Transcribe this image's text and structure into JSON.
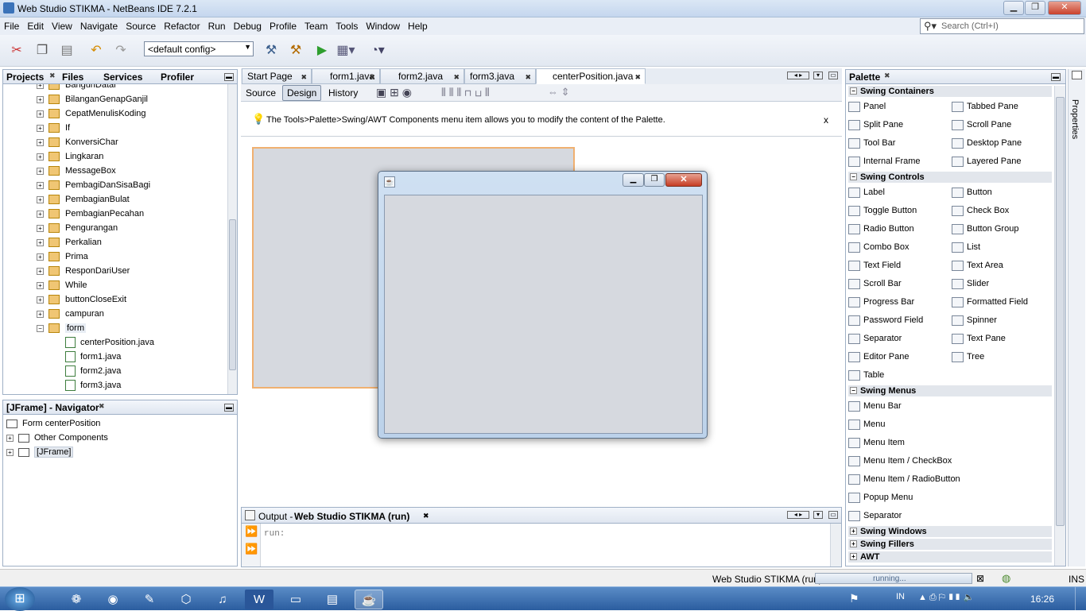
{
  "window": {
    "title": "Web Studio STIKMA - NetBeans IDE 7.2.1"
  },
  "menu": [
    "File",
    "Edit",
    "View",
    "Navigate",
    "Source",
    "Refactor",
    "Run",
    "Debug",
    "Profile",
    "Team",
    "Tools",
    "Window",
    "Help"
  ],
  "toolbar": {
    "config": "<default config>"
  },
  "search": {
    "placeholder": "Search (Ctrl+I)"
  },
  "projects": {
    "tabs": [
      "Projects",
      "Files",
      "Services",
      "Profiler"
    ],
    "tree": [
      {
        "label": "BangunDatar",
        "kind": "pkg"
      },
      {
        "label": "BilanganGenapGanjil",
        "kind": "pkg"
      },
      {
        "label": "CepatMenulisKoding",
        "kind": "pkg"
      },
      {
        "label": "If",
        "kind": "pkg"
      },
      {
        "label": "KonversiChar",
        "kind": "pkg"
      },
      {
        "label": "Lingkaran",
        "kind": "pkg"
      },
      {
        "label": "MessageBox",
        "kind": "pkg"
      },
      {
        "label": "PembagiDanSisaBagi",
        "kind": "pkg"
      },
      {
        "label": "PembagianBulat",
        "kind": "pkg"
      },
      {
        "label": "PembagianPecahan",
        "kind": "pkg"
      },
      {
        "label": "Pengurangan",
        "kind": "pkg"
      },
      {
        "label": "Perkalian",
        "kind": "pkg"
      },
      {
        "label": "Prima",
        "kind": "pkg"
      },
      {
        "label": "ResponDariUser",
        "kind": "pkg"
      },
      {
        "label": "While",
        "kind": "pkg"
      },
      {
        "label": "buttonCloseExit",
        "kind": "pkg"
      },
      {
        "label": "campuran",
        "kind": "pkg"
      },
      {
        "label": "form",
        "kind": "pkg"
      },
      {
        "label": "centerPosition.java",
        "kind": "file"
      },
      {
        "label": "form1.java",
        "kind": "file"
      },
      {
        "label": "form2.java",
        "kind": "file"
      },
      {
        "label": "form3.java",
        "kind": "file"
      }
    ]
  },
  "navigator": {
    "title": "[JFrame] - Navigator",
    "items": [
      "Form centerPosition",
      "Other Components",
      "[JFrame]"
    ]
  },
  "editor": {
    "tabs": [
      "Start Page",
      "form1.java",
      "form2.java",
      "form3.java",
      "centerPosition.java"
    ],
    "modes": [
      "Source",
      "Design",
      "History"
    ],
    "tip": "The Tools>Palette>Swing/AWT Components menu item allows you to modify the content of the Palette.",
    "tip_close": "x"
  },
  "output": {
    "label": "Output - ",
    "title": "Web Studio STIKMA (run)",
    "text": "run:"
  },
  "palette": {
    "title": "Palette",
    "side_tab": "Properties",
    "containers": {
      "label": "Swing Containers",
      "items": [
        "Panel",
        "Tabbed Pane",
        "Split Pane",
        "Scroll Pane",
        "Tool Bar",
        "Desktop Pane",
        "Internal Frame",
        "Layered Pane"
      ]
    },
    "controls": {
      "label": "Swing Controls",
      "items": [
        "Label",
        "Button",
        "Toggle Button",
        "Check Box",
        "Radio Button",
        "Button Group",
        "Combo Box",
        "List",
        "Text Field",
        "Text Area",
        "Scroll Bar",
        "Slider",
        "Progress Bar",
        "Formatted Field",
        "Password Field",
        "Spinner",
        "Separator",
        "Text Pane",
        "Editor Pane",
        "Tree",
        "Table"
      ]
    },
    "menus": {
      "label": "Swing Menus",
      "items": [
        "Menu Bar",
        "Menu",
        "Menu Item",
        "Menu Item / CheckBox",
        "Menu Item / RadioButton",
        "Popup Menu",
        "Separator"
      ]
    },
    "collapsed": [
      "Swing Windows",
      "Swing Fillers",
      "AWT"
    ]
  },
  "status": {
    "project": "Web Studio STIKMA (run)",
    "progress": "running...",
    "mode": "INS"
  },
  "taskbar": {
    "lang": "IN",
    "clock": "16:26"
  }
}
